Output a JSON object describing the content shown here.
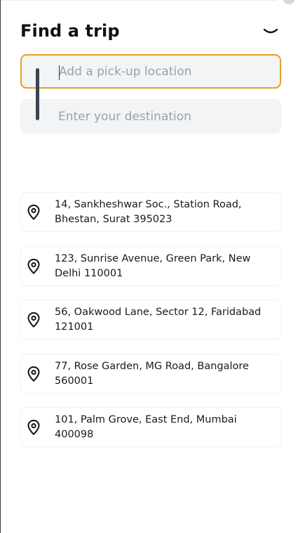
{
  "header": {
    "title": "Find a trip",
    "collapse_icon": "chevron-down-icon"
  },
  "inputs": {
    "pickup": {
      "placeholder": "Add a pick-up location",
      "value": ""
    },
    "destination": {
      "placeholder": "Enter your destination",
      "value": ""
    }
  },
  "colors": {
    "focus_border": "#e6a01e",
    "field_bg": "#f3f4f6",
    "connector": "#3c4450"
  },
  "recent_locations": [
    {
      "address": "14, Sankheshwar Soc., Station Road, Bhestan, Surat 395023",
      "icon": "map-pin-icon"
    },
    {
      "address": "123, Sunrise Avenue, Green Park, New Delhi 110001",
      "icon": "map-pin-icon"
    },
    {
      "address": "56, Oakwood Lane, Sector 12, Faridabad 121001",
      "icon": "map-pin-icon"
    },
    {
      "address": "77, Rose Garden, MG Road, Bangalore 560001",
      "icon": "map-pin-icon"
    },
    {
      "address": "101, Palm Grove, East End, Mumbai 400098",
      "icon": "map-pin-icon"
    }
  ]
}
